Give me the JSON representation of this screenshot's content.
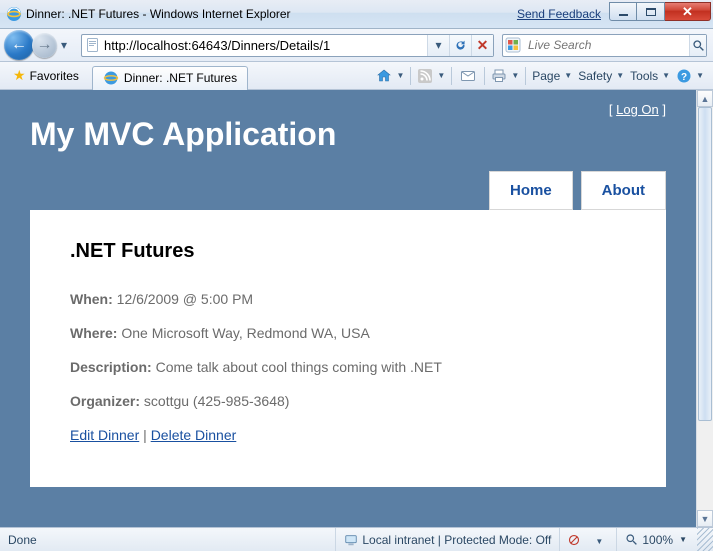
{
  "window": {
    "title": "Dinner: .NET Futures - Windows Internet Explorer",
    "feedback": "Send Feedback"
  },
  "nav": {
    "url": "http://localhost:64643/Dinners/Details/1",
    "search_placeholder": "Live Search"
  },
  "favbar": {
    "favorites_label": "Favorites",
    "tab_title": "Dinner: .NET Futures"
  },
  "cmdbar": {
    "page": "Page",
    "safety": "Safety",
    "tools": "Tools"
  },
  "page": {
    "logon": "Log On",
    "app_title": "My MVC Application",
    "nav": {
      "home": "Home",
      "about": "About"
    },
    "heading": ".NET Futures",
    "when_label": "When:",
    "when_value": "12/6/2009 @ 5:00 PM",
    "where_label": "Where:",
    "where_value": "One Microsoft Way, Redmond WA, USA",
    "desc_label": "Description:",
    "desc_value": "Come talk about cool things coming with .NET",
    "org_label": "Organizer:",
    "org_value": "scottgu (425-985-3648)",
    "edit": "Edit Dinner",
    "delete": "Delete Dinner"
  },
  "status": {
    "done": "Done",
    "zone": "Local intranet | Protected Mode: Off",
    "zoom": "100%"
  }
}
